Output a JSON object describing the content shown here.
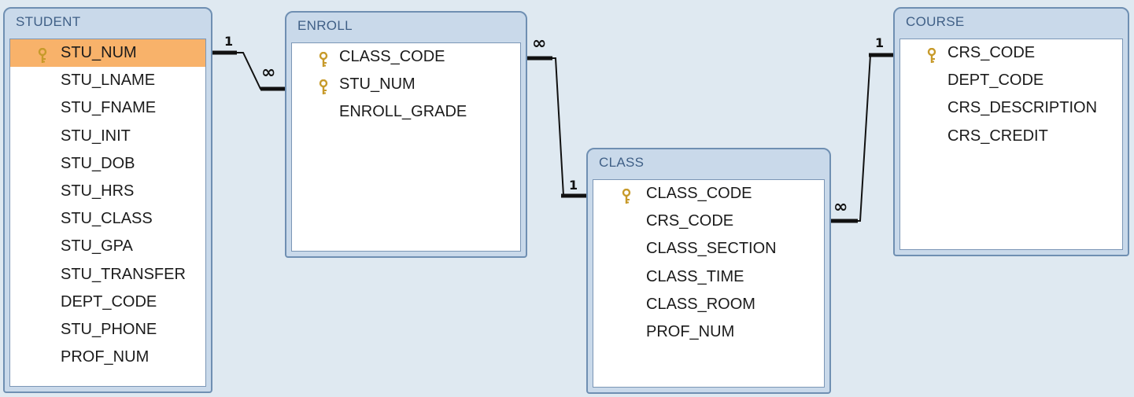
{
  "tables": {
    "student": {
      "title": "STUDENT",
      "fields": [
        {
          "name": "STU_NUM",
          "key": true,
          "selected": true
        },
        {
          "name": "STU_LNAME"
        },
        {
          "name": "STU_FNAME"
        },
        {
          "name": "STU_INIT"
        },
        {
          "name": "STU_DOB"
        },
        {
          "name": "STU_HRS"
        },
        {
          "name": "STU_CLASS"
        },
        {
          "name": "STU_GPA"
        },
        {
          "name": "STU_TRANSFER"
        },
        {
          "name": "DEPT_CODE"
        },
        {
          "name": "STU_PHONE"
        },
        {
          "name": "PROF_NUM"
        }
      ]
    },
    "enroll": {
      "title": "ENROLL",
      "fields": [
        {
          "name": "CLASS_CODE",
          "key": true
        },
        {
          "name": "STU_NUM",
          "key": true
        },
        {
          "name": "ENROLL_GRADE"
        }
      ]
    },
    "class": {
      "title": "CLASS",
      "fields": [
        {
          "name": "CLASS_CODE",
          "key": true
        },
        {
          "name": "CRS_CODE"
        },
        {
          "name": "CLASS_SECTION"
        },
        {
          "name": "CLASS_TIME"
        },
        {
          "name": "CLASS_ROOM"
        },
        {
          "name": "PROF_NUM"
        }
      ]
    },
    "course": {
      "title": "COURSE",
      "fields": [
        {
          "name": "CRS_CODE",
          "key": true
        },
        {
          "name": "DEPT_CODE"
        },
        {
          "name": "CRS_DESCRIPTION"
        },
        {
          "name": "CRS_CREDIT"
        }
      ]
    }
  },
  "relationships": [
    {
      "from_table": "STUDENT",
      "to_table": "ENROLL",
      "from_card": "1",
      "to_card": "∞"
    },
    {
      "from_table": "CLASS",
      "to_table": "ENROLL",
      "from_card": "1",
      "to_card": "∞"
    },
    {
      "from_table": "COURSE",
      "to_table": "CLASS",
      "from_card": "1",
      "to_card": "∞"
    }
  ],
  "colors": {
    "background": "#dfe9f1",
    "table_header": "#c9d9ea",
    "table_border": "#6f8fb2",
    "selected_field": "#f8b26a",
    "key_icon": "#c79a2a",
    "line": "#111111"
  }
}
